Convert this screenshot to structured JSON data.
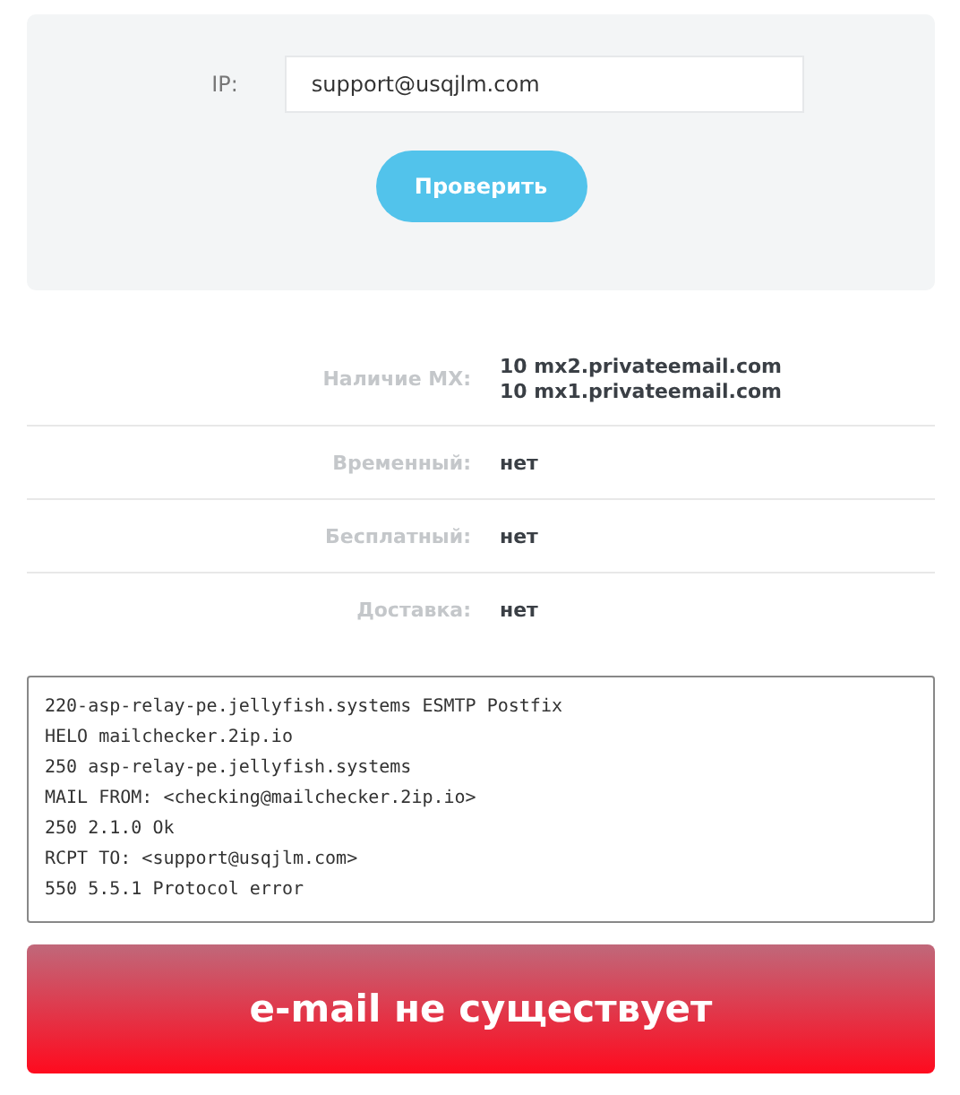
{
  "form": {
    "label": "IP:",
    "value": "support@usqjlm.com",
    "button": "Проверить"
  },
  "info": [
    {
      "label": "Наличие MX:",
      "values": [
        "10 mx2.privateemail.com",
        "10 mx1.privateemail.com"
      ]
    },
    {
      "label": "Временный:",
      "values": [
        "нет"
      ]
    },
    {
      "label": "Бесплатный:",
      "values": [
        "нет"
      ]
    },
    {
      "label": "Доставка:",
      "values": [
        "нет"
      ]
    }
  ],
  "log": [
    "220-asp-relay-pe.jellyfish.systems ESMTP Postfix",
    "HELO mailchecker.2ip.io",
    "250 asp-relay-pe.jellyfish.systems",
    "MAIL FROM: <checking@mailchecker.2ip.io>",
    "250 2.1.0 Ok",
    "RCPT TO: <support@usqjlm.com>",
    "550 5.5.1 Protocol error"
  ],
  "result": {
    "text": "e-mail не существует",
    "kind": "error"
  }
}
